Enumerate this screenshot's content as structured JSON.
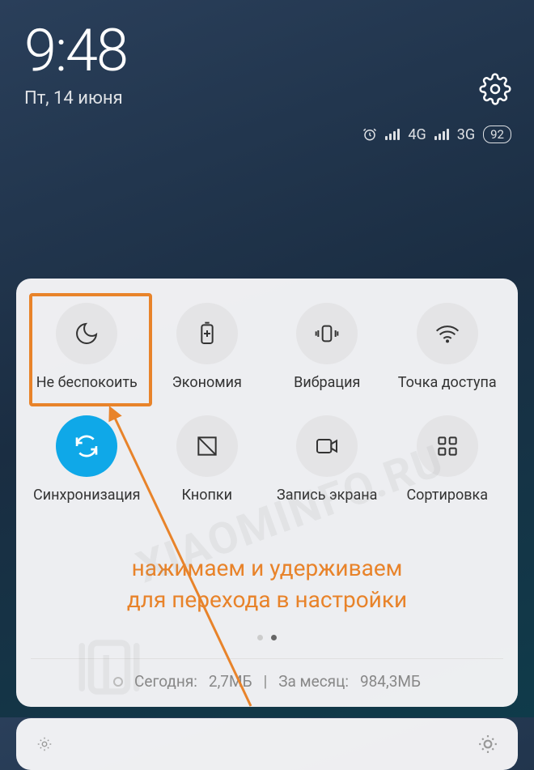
{
  "status": {
    "time": "9:48",
    "date": "Пт, 14 июня",
    "network1": "4G",
    "network2": "3G",
    "battery": "92"
  },
  "tiles": [
    {
      "label": "Не беспокоить",
      "icon": "moon"
    },
    {
      "label": "Экономия",
      "icon": "battery-plus"
    },
    {
      "label": "Вибрация",
      "icon": "vibrate"
    },
    {
      "label": "Точка доступа",
      "icon": "hotspot"
    },
    {
      "label": "Синхронизация",
      "icon": "sync",
      "active": true
    },
    {
      "label": "Кнопки",
      "icon": "buttons"
    },
    {
      "label": "Запись экрана",
      "icon": "record"
    },
    {
      "label": "Сортировка",
      "icon": "grid"
    }
  ],
  "annotation": {
    "line1": "нажимаем и удерживаем",
    "line2": "для перехода в настройки"
  },
  "usage": {
    "today_label": "Сегодня:",
    "today_val": "2,7МБ",
    "sep": "|",
    "month_label": "За месяц:",
    "month_val": "984,3МБ"
  },
  "watermark": "XIAOMINFO.RU"
}
